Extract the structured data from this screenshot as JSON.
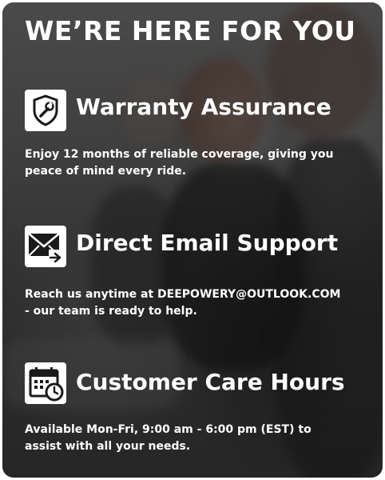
{
  "headline": "WE’RE HERE FOR YOU",
  "sections": [
    {
      "icon": "shield-wrench-icon",
      "title": "Warranty Assurance",
      "text_lines": [
        "Enjoy 12 months of reliable coverage, giving you",
        "peace of mind every ride."
      ]
    },
    {
      "icon": "email-forward-icon",
      "title": "Direct Email Support",
      "text_lines": [
        "Reach us anytime at DEEPOWERY@OUTLOOK.COM",
        " - our team is ready to help."
      ]
    },
    {
      "icon": "calendar-clock-icon",
      "title": "Customer Care Hours",
      "text_lines": [
        "Available Mon-Fri, 9:00 am - 6:00 pm (EST) to",
        "assist with all your needs."
      ]
    }
  ],
  "colors": {
    "text": "#ffffff",
    "icon_background": "#ffffff",
    "icon_foreground": "#1a1a1a"
  }
}
